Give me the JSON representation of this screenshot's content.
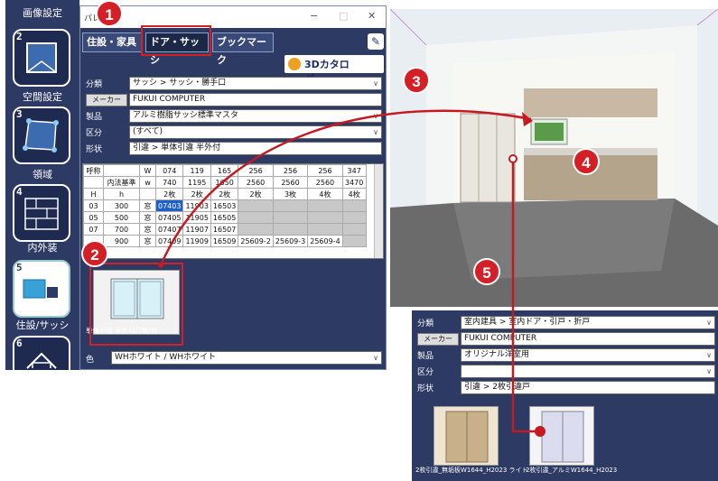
{
  "left_toolbar": {
    "top_label": "画像設定",
    "tiles": [
      {
        "num": "2",
        "label": "空間設定"
      },
      {
        "num": "3",
        "label": "領域"
      },
      {
        "num": "4",
        "label": "内外装"
      },
      {
        "num": "5",
        "label": "住設/サッシ"
      },
      {
        "num": "6",
        "label": ""
      }
    ]
  },
  "palette": {
    "title": "パレット",
    "win_min": "−",
    "win_max": "□",
    "win_close": "✕",
    "tabs": [
      "住設・家具",
      "ドア・サッシ",
      "ブックマーク"
    ],
    "catalog_logo": "3Dカタログ.com",
    "form": {
      "category_label": "分類",
      "category_value": "サッシ > サッシ・勝手口",
      "maker_button": "メーカー",
      "maker_value": "FUKUI COMPUTER",
      "product_label": "製品",
      "product_value": "アルミ樹脂サッシ標準マスタ",
      "division_label": "区分",
      "division_value": "(すべて)",
      "shape_label": "形状",
      "shape_value": "引違 > 単体引違 半外付"
    },
    "grid": {
      "rows": [
        [
          "呼称",
          "",
          "W",
          "074",
          "119",
          "165",
          "256",
          "256",
          "256",
          "347"
        ],
        [
          "",
          "内法基準",
          "w",
          "740",
          "1195",
          "1650",
          "2560",
          "2560",
          "2560",
          "3470"
        ],
        [
          "H",
          "h",
          "",
          "2枚",
          "2枚",
          "2枚",
          "2枚",
          "3枚",
          "4枚",
          "4枚"
        ],
        [
          "03",
          "300",
          "窓",
          "07403",
          "11903",
          "16503",
          "",
          "",
          "",
          ""
        ],
        [
          "05",
          "500",
          "窓",
          "07405",
          "11905",
          "16505",
          "",
          "",
          "",
          ""
        ],
        [
          "07",
          "700",
          "窓",
          "07407",
          "11907",
          "16507",
          "",
          "",
          "",
          ""
        ],
        [
          "",
          "900",
          "窓",
          "07409",
          "11909",
          "16509",
          "25609-2",
          "25609-3",
          "25609-4",
          ""
        ]
      ]
    },
    "list_item_caption": "単体引違 半外付/2枚/窓",
    "color_label": "色",
    "color_value": "WHホワイト / WHホワイト"
  },
  "subpanel": {
    "category_label": "分類",
    "category_value": "室内建具 > 室内ドア・引戸・折戸",
    "maker_button": "メーカー",
    "maker_value": "FUKUI COMPUTER",
    "product_label": "製品",
    "product_value": "オリジナル洋室用",
    "division_label": "区分",
    "division_value": "",
    "shape_label": "形状",
    "shape_value": "引違 > 2枚引違戸",
    "items": [
      {
        "caption": "2枚引違_無垢板W1644_H2023 ライト"
      },
      {
        "caption": "2枚引違_アルミW1644_H2023"
      }
    ]
  },
  "callouts": [
    "1",
    "2",
    "3",
    "4",
    "5"
  ],
  "colors": {
    "panel": "#2d3a63",
    "accent": "#d32027",
    "highlight": "#1e60c8"
  }
}
